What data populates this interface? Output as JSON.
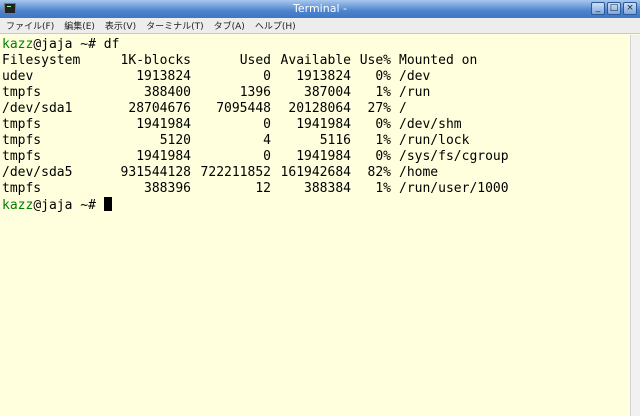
{
  "window": {
    "title": "Terminal -"
  },
  "menu": [
    {
      "label": "ファイル(F)"
    },
    {
      "label": "編集(E)"
    },
    {
      "label": "表示(V)"
    },
    {
      "label": "ターミナル(T)"
    },
    {
      "label": "タブ(A)"
    },
    {
      "label": "ヘルプ(H)"
    }
  ],
  "prompt": {
    "user": "kazz",
    "host_suffix": "@jaja ~# ",
    "command": "df"
  },
  "df": {
    "headers": [
      "Filesystem",
      "1K-blocks",
      "Used",
      "Available",
      "Use%",
      "Mounted on"
    ],
    "rows": [
      [
        "udev",
        "1913824",
        "0",
        "1913824",
        "0%",
        "/dev"
      ],
      [
        "tmpfs",
        "388400",
        "1396",
        "387004",
        "1%",
        "/run"
      ],
      [
        "/dev/sda1",
        "28704676",
        "7095448",
        "20128064",
        "27%",
        "/"
      ],
      [
        "tmpfs",
        "1941984",
        "0",
        "1941984",
        "0%",
        "/dev/shm"
      ],
      [
        "tmpfs",
        "5120",
        "4",
        "5116",
        "1%",
        "/run/lock"
      ],
      [
        "tmpfs",
        "1941984",
        "0",
        "1941984",
        "0%",
        "/sys/fs/cgroup"
      ],
      [
        "/dev/sda5",
        "931544128",
        "722211852",
        "161942684",
        "82%",
        "/home"
      ],
      [
        "tmpfs",
        "388396",
        "12",
        "388384",
        "1%",
        "/run/user/1000"
      ]
    ]
  },
  "prompt2": {
    "user": "kazz",
    "host_suffix": "@jaja ~# "
  }
}
